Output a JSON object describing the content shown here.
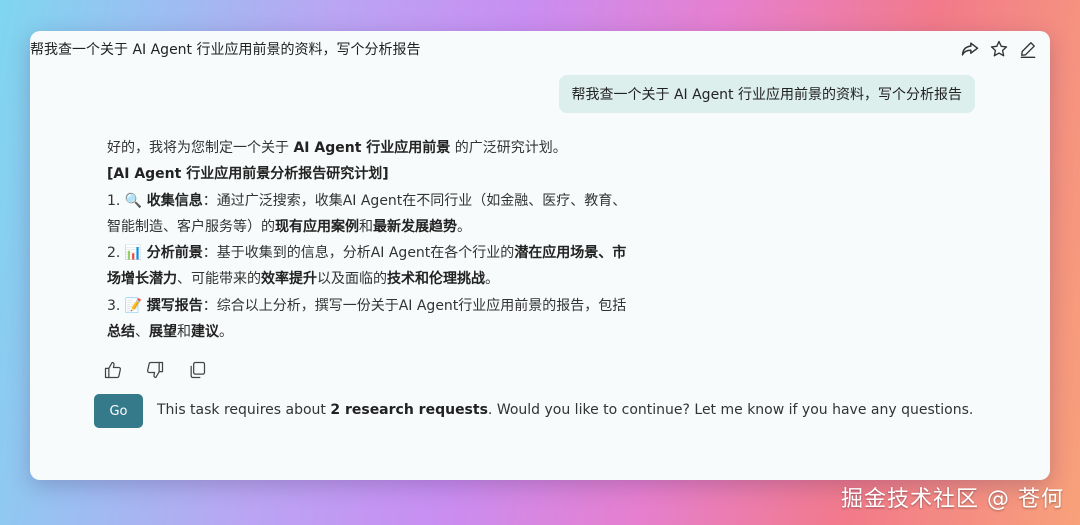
{
  "header": {
    "title": "帮我查一个关于 AI Agent 行业应用前景的资料，写个分析报告",
    "icons": [
      "share-icon",
      "star-icon",
      "edit-icon"
    ]
  },
  "user_message": "帮我查一个关于 AI Agent 行业应用前景的资料，写个分析报告",
  "answer": {
    "intro_prefix": "好的，我将为您制定一个关于 ",
    "intro_bold": "AI Agent 行业应用前景",
    "intro_suffix": " 的广泛研究计划。",
    "plan_title": "[AI Agent 行业应用前景分析报告研究计划]",
    "items": [
      {
        "num": "1. ",
        "emoji": "🔍",
        "label": "收集信息",
        "t1": "：通过广泛搜索，收集AI Agent在不同行业（如金融、医疗、教育、智能制造、客户服务等）的",
        "b1": "现有应用案例",
        "t2": "和",
        "b2": "最新发展趋势",
        "t3": "。"
      },
      {
        "num": "2. ",
        "emoji": "📊",
        "label": "分析前景",
        "t1": "：基于收集到的信息，分析AI Agent在各个行业的",
        "b1": "潜在应用场景、市场增长潜力",
        "t2": "、可能带来的",
        "b2": "效率提升",
        "t3": "以及面临的",
        "b3": "技术和伦理挑战",
        "t4": "。"
      },
      {
        "num": "3. ",
        "emoji": "📝",
        "label": "撰写报告",
        "t1": "：综合以上分析，撰写一份关于AI Agent行业应用前景的报告，包括",
        "b1": "总结",
        "t2": "、",
        "b2": "展望",
        "t3": "和",
        "b3": "建议",
        "t4": "。"
      }
    ]
  },
  "reactions": [
    "thumbs-up-icon",
    "thumbs-down-icon",
    "copy-icon"
  ],
  "continue": {
    "button_label": "Go",
    "text_prefix": "This task requires about ",
    "text_bold": "2 research requests",
    "text_suffix": ". Would you like to continue?  Let me know if you have any questions."
  },
  "watermark": "掘金技术社区 @ 苍何",
  "colors": {
    "accent": "#347a8a",
    "user_bubble": "#dcefec",
    "card_bg": "#f7fbfb"
  }
}
